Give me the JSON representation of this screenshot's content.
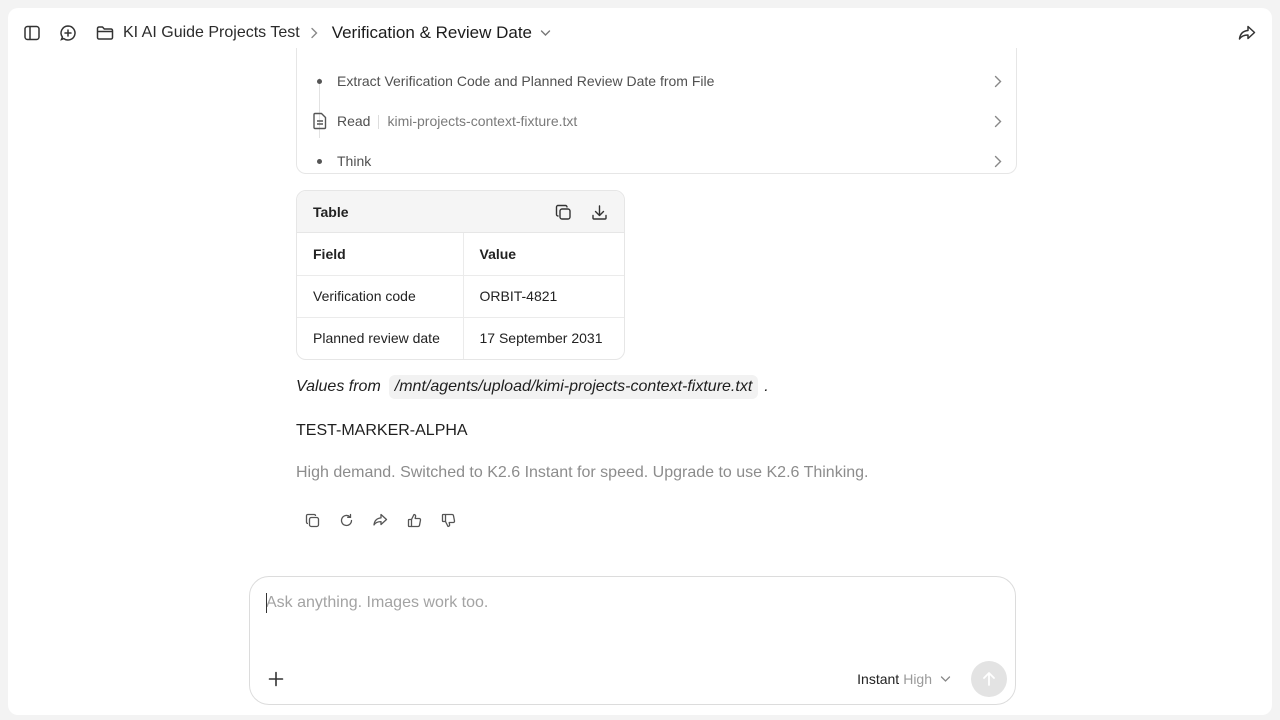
{
  "header": {
    "project_name": "KI AI Guide Projects Test",
    "chat_title": "Verification & Review Date"
  },
  "steps": [
    {
      "type": "bullet",
      "label": "Extract Verification Code and Planned Review Date from File"
    },
    {
      "type": "read",
      "label": "Read",
      "file": "kimi-projects-context-fixture.txt"
    },
    {
      "type": "bullet",
      "label": "Think"
    }
  ],
  "table": {
    "title": "Table",
    "headers": [
      "Field",
      "Value"
    ],
    "rows": [
      [
        "Verification code",
        "ORBIT-4821"
      ],
      [
        "Planned review date",
        "17 September 2031"
      ]
    ]
  },
  "message": {
    "source_prefix": "Values from",
    "source_path": "/mnt/agents/upload/kimi-projects-context-fixture.txt",
    "source_suffix": ".",
    "marker": "TEST-MARKER-ALPHA",
    "notice": "High demand. Switched to K2.6 Instant for speed. Upgrade to use K2.6 Thinking."
  },
  "composer": {
    "placeholder": "Ask anything. Images work too.",
    "mode_name": "Instant",
    "mode_level": "High"
  },
  "icons": {
    "sidebar_toggle": "sidebar-icon",
    "new_chat": "new-chat-icon",
    "folder": "folder-icon",
    "share": "share-icon",
    "copy": "copy-icon",
    "download": "download-icon",
    "regenerate": "refresh-icon",
    "like": "thumbs-up-icon",
    "dislike": "thumbs-down-icon",
    "add": "plus-icon",
    "send": "arrow-up-icon"
  }
}
